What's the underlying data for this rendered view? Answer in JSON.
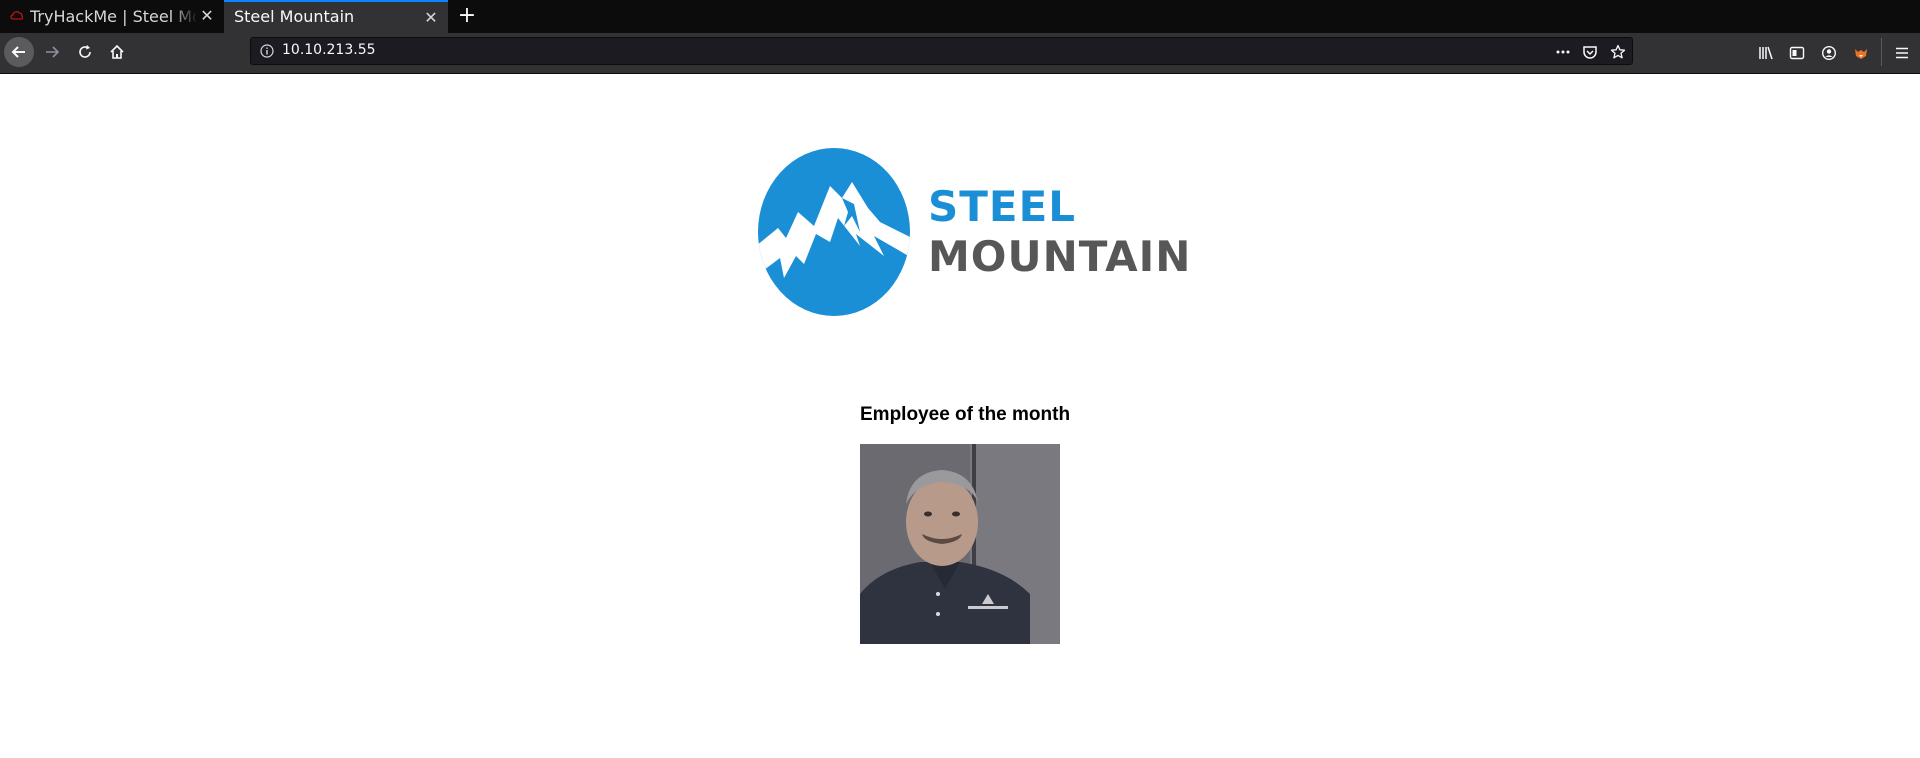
{
  "tabs": [
    {
      "title": "TryHackMe | Steel Mount",
      "active": false
    },
    {
      "title": "Steel Mountain",
      "active": true
    }
  ],
  "urlbar": {
    "url": "10.10.213.55"
  },
  "icons": {
    "back": "back-arrow-icon",
    "forward": "forward-arrow-icon",
    "reload": "reload-icon",
    "home": "home-icon",
    "page_actions": "more-dots-icon",
    "pocket": "pocket-icon",
    "bookmark": "star-icon",
    "library": "library-icon",
    "sidebar": "sidebar-icon",
    "account": "account-icon",
    "extension": "fox-extension-icon",
    "menu": "hamburger-menu-icon"
  },
  "page": {
    "logo": {
      "line1": "STEEL",
      "line2": "MOUNTAIN"
    },
    "heading": "Employee of the month"
  },
  "colors": {
    "brand_blue": "#1a8fd6",
    "brand_gray": "#575757",
    "tab_accent": "#0a84ff"
  }
}
